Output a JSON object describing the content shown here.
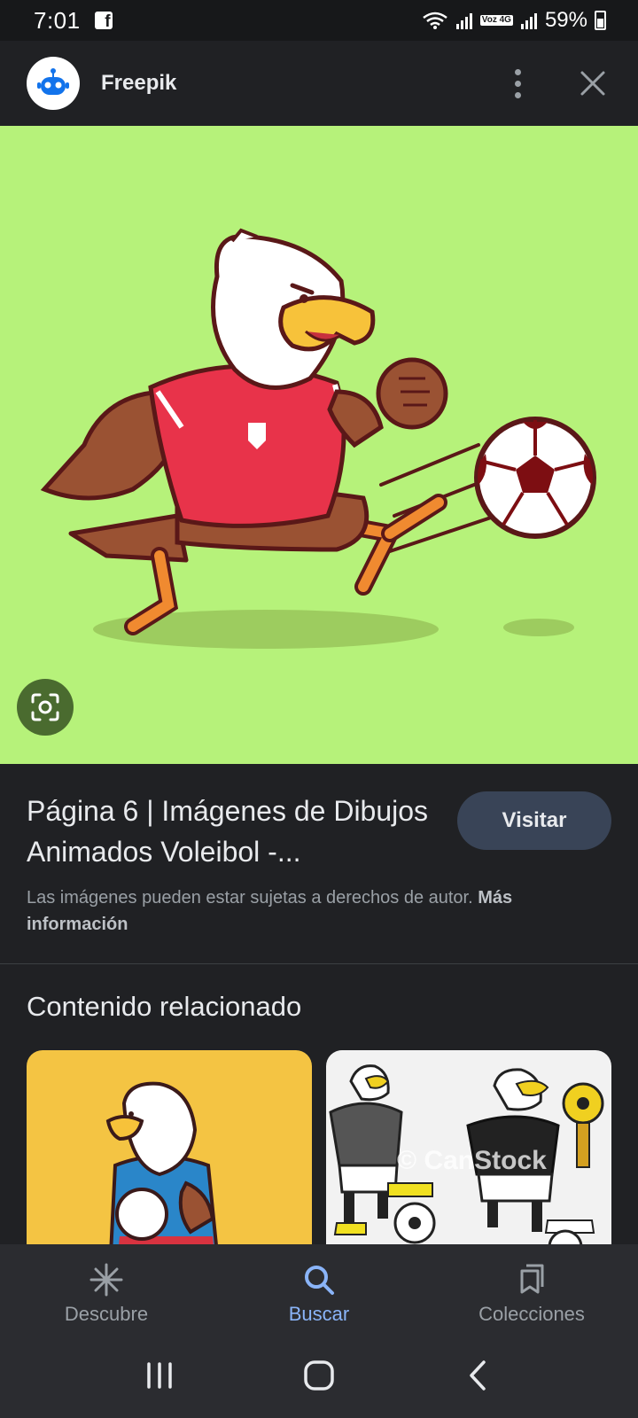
{
  "status_bar": {
    "time": "7:01",
    "battery": "59%",
    "network_badge": "Voz 4G"
  },
  "appbar": {
    "site_name": "Freepik"
  },
  "result": {
    "title": "Página 6 | Imágenes de Dibujos Animados Voleibol -...",
    "visit_label": "Visitar",
    "copyright_text": "Las imágenes pueden estar sujetas a derechos de autor.",
    "copyright_link": "Más información"
  },
  "related": {
    "title": "Contenido relacionado",
    "watermark": "© CanStock"
  },
  "bottom_nav": {
    "items": [
      {
        "label": "Descubre",
        "icon": "asterisk-icon"
      },
      {
        "label": "Buscar",
        "icon": "search-icon",
        "active": true
      },
      {
        "label": "Colecciones",
        "icon": "collections-icon"
      }
    ]
  },
  "colors": {
    "hero_background": "#b6f27a",
    "accent": "#8ab4f8",
    "visit_button": "#394457"
  }
}
